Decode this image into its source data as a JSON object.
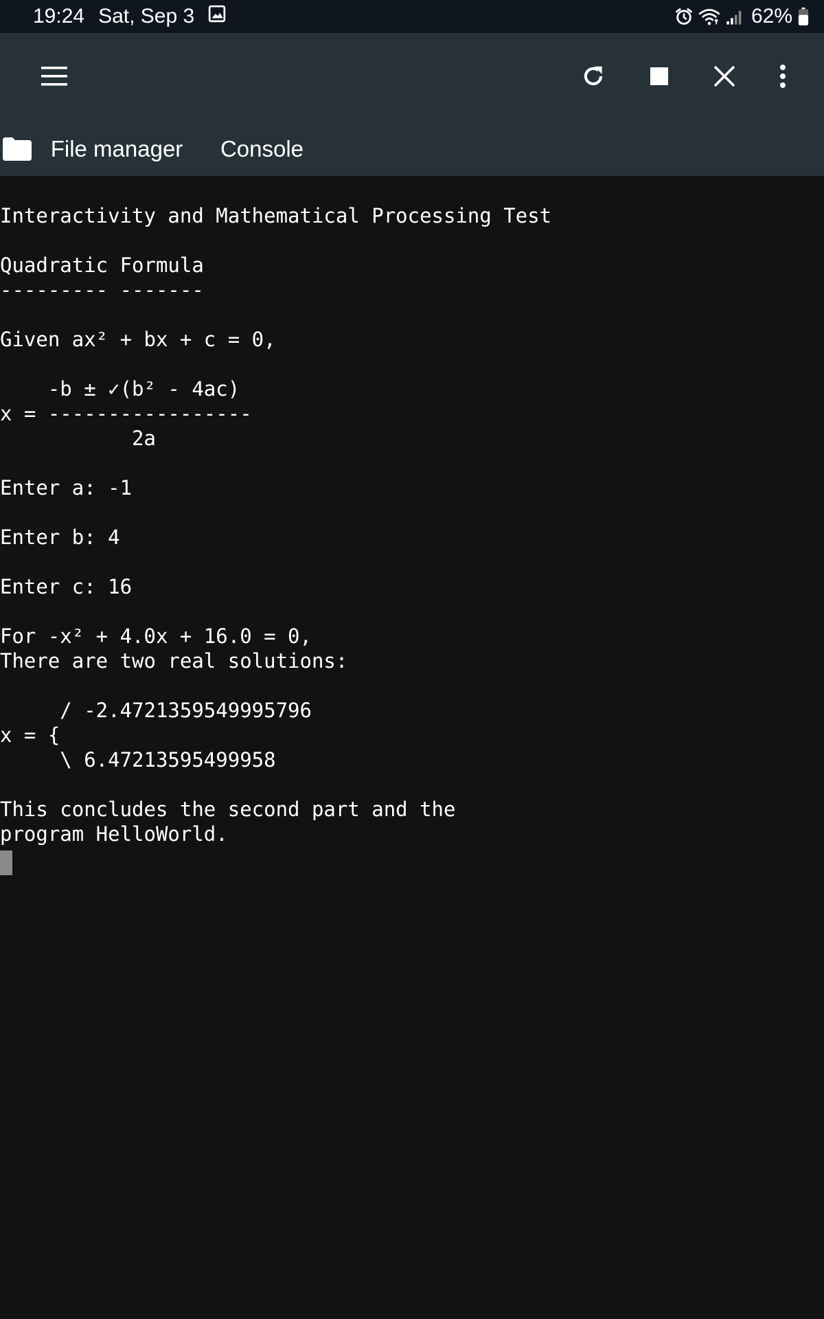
{
  "status_bar": {
    "time": "19:24",
    "date": "Sat, Sep 3",
    "battery": "62%",
    "icons": [
      "gallery-icon",
      "alarm-icon",
      "wifi-icon",
      "signal-icon",
      "battery-icon"
    ]
  },
  "toolbar": {
    "icons": [
      "menu-icon",
      "refresh-icon",
      "stop-icon",
      "close-icon",
      "more-vert-icon"
    ]
  },
  "tabs": [
    {
      "label": "File manager",
      "selected": false
    },
    {
      "label": "Console",
      "selected": true
    }
  ],
  "console": {
    "lines": [
      "",
      "Interactivity and Mathematical Processing Test",
      "",
      "Quadratic Formula",
      "--------- -------",
      "",
      "Given ax² + bx + c = 0,",
      "",
      "    -b ± ✓(b² - 4ac)",
      "x = -----------------",
      "           2a",
      "",
      "Enter a: -1",
      "",
      "Enter b: 4",
      "",
      "Enter c: 16",
      "",
      "For -x² + 4.0x + 16.0 = 0,",
      "There are two real solutions:",
      "",
      "     / -2.4721359549995796",
      "x = {",
      "     \\ 6.47213595499958",
      "",
      "This concludes the second part and the",
      "program HelloWorld."
    ]
  },
  "colors": {
    "status_bar_bg": "#0f1620",
    "app_bar_bg": "#263238",
    "console_bg": "#121212",
    "text": "#ffffff",
    "cursor": "#8a8a8a"
  }
}
